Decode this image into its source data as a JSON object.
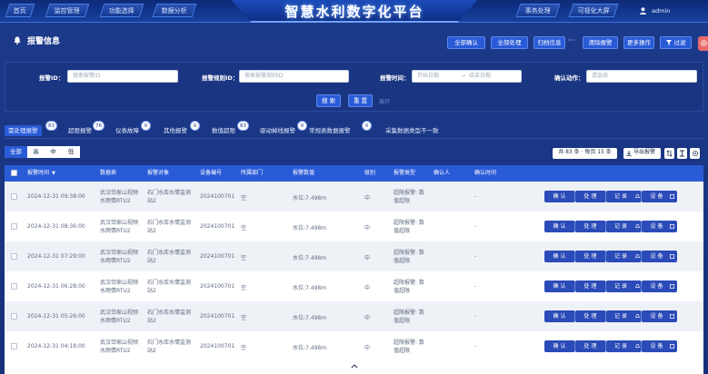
{
  "nav": {
    "left_tabs": [
      "首页",
      "监控管理",
      "功能选择",
      "数据分析"
    ],
    "brand": "智慧水利数字化平台",
    "right_tabs": [
      "事务处理",
      "可视化大屏"
    ],
    "user": "admin"
  },
  "page": {
    "title": "报警信息",
    "toolbar": [
      "全部确认",
      "全部处理",
      "归档信息",
      "清除报警",
      "更多操作",
      "过滤"
    ],
    "toolbar_more": "···"
  },
  "filter": {
    "alarm_id_label": "报警ID：",
    "alarm_id_placeholder": "搜索报警ID",
    "rule_id_label": "报警规则ID：",
    "rule_id_placeholder": "搜索报警规则ID",
    "time_label": "报警时间：",
    "start_placeholder": "开始日期",
    "date_sep": "→",
    "end_placeholder": "结束日期",
    "confirm_label": "确认动作：",
    "confirm_placeholder": "请选择",
    "search_btn": "搜 索",
    "reset_btn": "重 置",
    "fold": "展开"
  },
  "categories": [
    {
      "label": "需处理报警",
      "count": "83"
    },
    {
      "label": "超限报警",
      "count": "76"
    },
    {
      "label": "仪表故障",
      "count": "0"
    },
    {
      "label": "其他报警",
      "count": "0"
    },
    {
      "label": "数值超限",
      "count": "83"
    },
    {
      "label": "驱动掉线报警",
      "count": "0"
    },
    {
      "label": "常规表数据报警",
      "count": "0"
    },
    {
      "label": "采集数据类型不一致",
      "count": "0"
    }
  ],
  "levels": [
    "全部",
    "高",
    "中",
    "低"
  ],
  "pager": {
    "info": "共 83 条 · 每页 15 条",
    "export": "导出报警"
  },
  "table": {
    "headers": [
      "报警时间",
      "数据表",
      "报警对象",
      "设备编号",
      "所属部门",
      "报警数值",
      "级别",
      "报警类型",
      "确认人",
      "确认时间"
    ],
    "sort_indicator": "▼",
    "rows": [
      {
        "time": "2024-12-31 09:38:00",
        "table1": "武汉岱家山视频",
        "table2": "水雨情RTU2",
        "obj1": "石门水库水情监测",
        "obj2": "站2",
        "device": "2024100701",
        "dept": "空",
        "value": "水位:7.498m",
        "level": "中",
        "type1": "超限报警: 数",
        "type2": "值超限",
        "confirmer": "",
        "confirm_time": "-"
      },
      {
        "time": "2024-12-31 08:36:00",
        "table1": "武汉岱家山视频",
        "table2": "水雨情RTU2",
        "obj1": "石门水库水情监测",
        "obj2": "站2",
        "device": "2024100701",
        "dept": "空",
        "value": "水位:7.498m",
        "level": "中",
        "type1": "超限报警: 数",
        "type2": "值超限",
        "confirmer": "",
        "confirm_time": "-"
      },
      {
        "time": "2024-12-31 07:29:00",
        "table1": "武汉岱家山视频",
        "table2": "水雨情RTU2",
        "obj1": "石门水库水情监测",
        "obj2": "站2",
        "device": "2024100701",
        "dept": "空",
        "value": "水位:7.498m",
        "level": "中",
        "type1": "超限报警: 数",
        "type2": "值超限",
        "confirmer": "",
        "confirm_time": "-"
      },
      {
        "time": "2024-12-31 06:28:00",
        "table1": "武汉岱家山视频",
        "table2": "水雨情RTU2",
        "obj1": "石门水库水情监测",
        "obj2": "站2",
        "device": "2024100701",
        "dept": "空",
        "value": "水位:7.498m",
        "level": "中",
        "type1": "超限报警: 数",
        "type2": "值超限",
        "confirmer": "",
        "confirm_time": "-"
      },
      {
        "time": "2024-12-31 05:26:00",
        "table1": "武汉岱家山视频",
        "table2": "水雨情RTU2",
        "obj1": "石门水库水情监测",
        "obj2": "站2",
        "device": "2024100701",
        "dept": "空",
        "value": "水位:7.498m",
        "level": "中",
        "type1": "超限报警: 数",
        "type2": "值超限",
        "confirmer": "",
        "confirm_time": "-"
      },
      {
        "time": "2024-12-31 04:18:00",
        "table1": "武汉岱家山视频",
        "table2": "水雨情RTU2",
        "obj1": "石门水库水情监测",
        "obj2": "站2",
        "device": "2024100701",
        "dept": "空",
        "value": "水位:7.498m",
        "level": "中",
        "type1": "超限报警: 数",
        "type2": "值超限",
        "confirmer": "",
        "confirm_time": "-"
      }
    ],
    "actions": [
      "确 认",
      "处 理",
      "记 录",
      "设 备"
    ]
  },
  "colors": {
    "primary": "#2a5bd7",
    "panel": "#17307a",
    "nav": "#0d2a78",
    "action": "#2b4bb8"
  }
}
